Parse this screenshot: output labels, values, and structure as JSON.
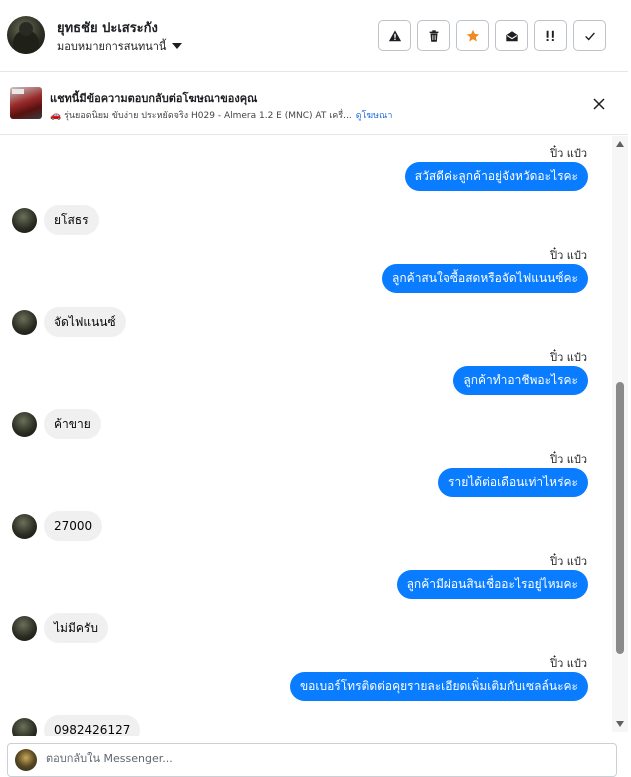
{
  "header": {
    "contact_name": "ยุทธชัย ปะเสระกัง",
    "assign_label": "มอบหมายการสนทนานี้",
    "actions": [
      {
        "icon": "warning-icon",
        "name": "mark-spam-button"
      },
      {
        "icon": "trash-icon",
        "name": "delete-button"
      },
      {
        "icon": "star-icon",
        "name": "star-button"
      },
      {
        "icon": "mark-unread-icon",
        "name": "mark-unread-button"
      },
      {
        "icon": "follow-up-icon",
        "name": "follow-up-button"
      },
      {
        "icon": "check-icon",
        "name": "mark-done-button"
      }
    ],
    "star_color": "#f08a24"
  },
  "ad": {
    "title": "แชทนี้มีข้อความตอบกลับต่อโฆษณาของคุณ",
    "subtitle": "🚗 รุ่นยอดนิยม ขับง่าย ประหยัดจริง H029 - Almera 1.2 E (MNC) AT เครื่...",
    "link": "ดูโฆษณา"
  },
  "conversation": {
    "sender_name": "ปิ๋ว แป๋ว",
    "outgoing": [
      "สวัสดีค่ะลูกค้าอยู่จังหวัดอะไรคะ",
      "ลูกค้าสนใจซื้อสดหรือจัดไฟแนนซ์คะ",
      "ลูกค้าทำอาชีพอะไรคะ",
      "รายได้ต่อเดือนเท่าไหร่คะ",
      "ลูกค้ามีผ่อนสินเชื่ออะไรอยู่ไหมคะ",
      "ขอเบอร์โทรติดต่อคุยรายละเอียดเพิ่มเติมกับเซลล์นะคะ"
    ],
    "incoming": [
      "ยโสธร",
      "จัดไฟแนนซ์",
      "ค้าขาย",
      "27000",
      "ไม่มีครับ",
      "0982426127"
    ],
    "outgoing_color": "#0a7cff",
    "incoming_color": "#f0f0f0"
  },
  "reply": {
    "placeholder": "ตอบกลับใน Messenger..."
  }
}
